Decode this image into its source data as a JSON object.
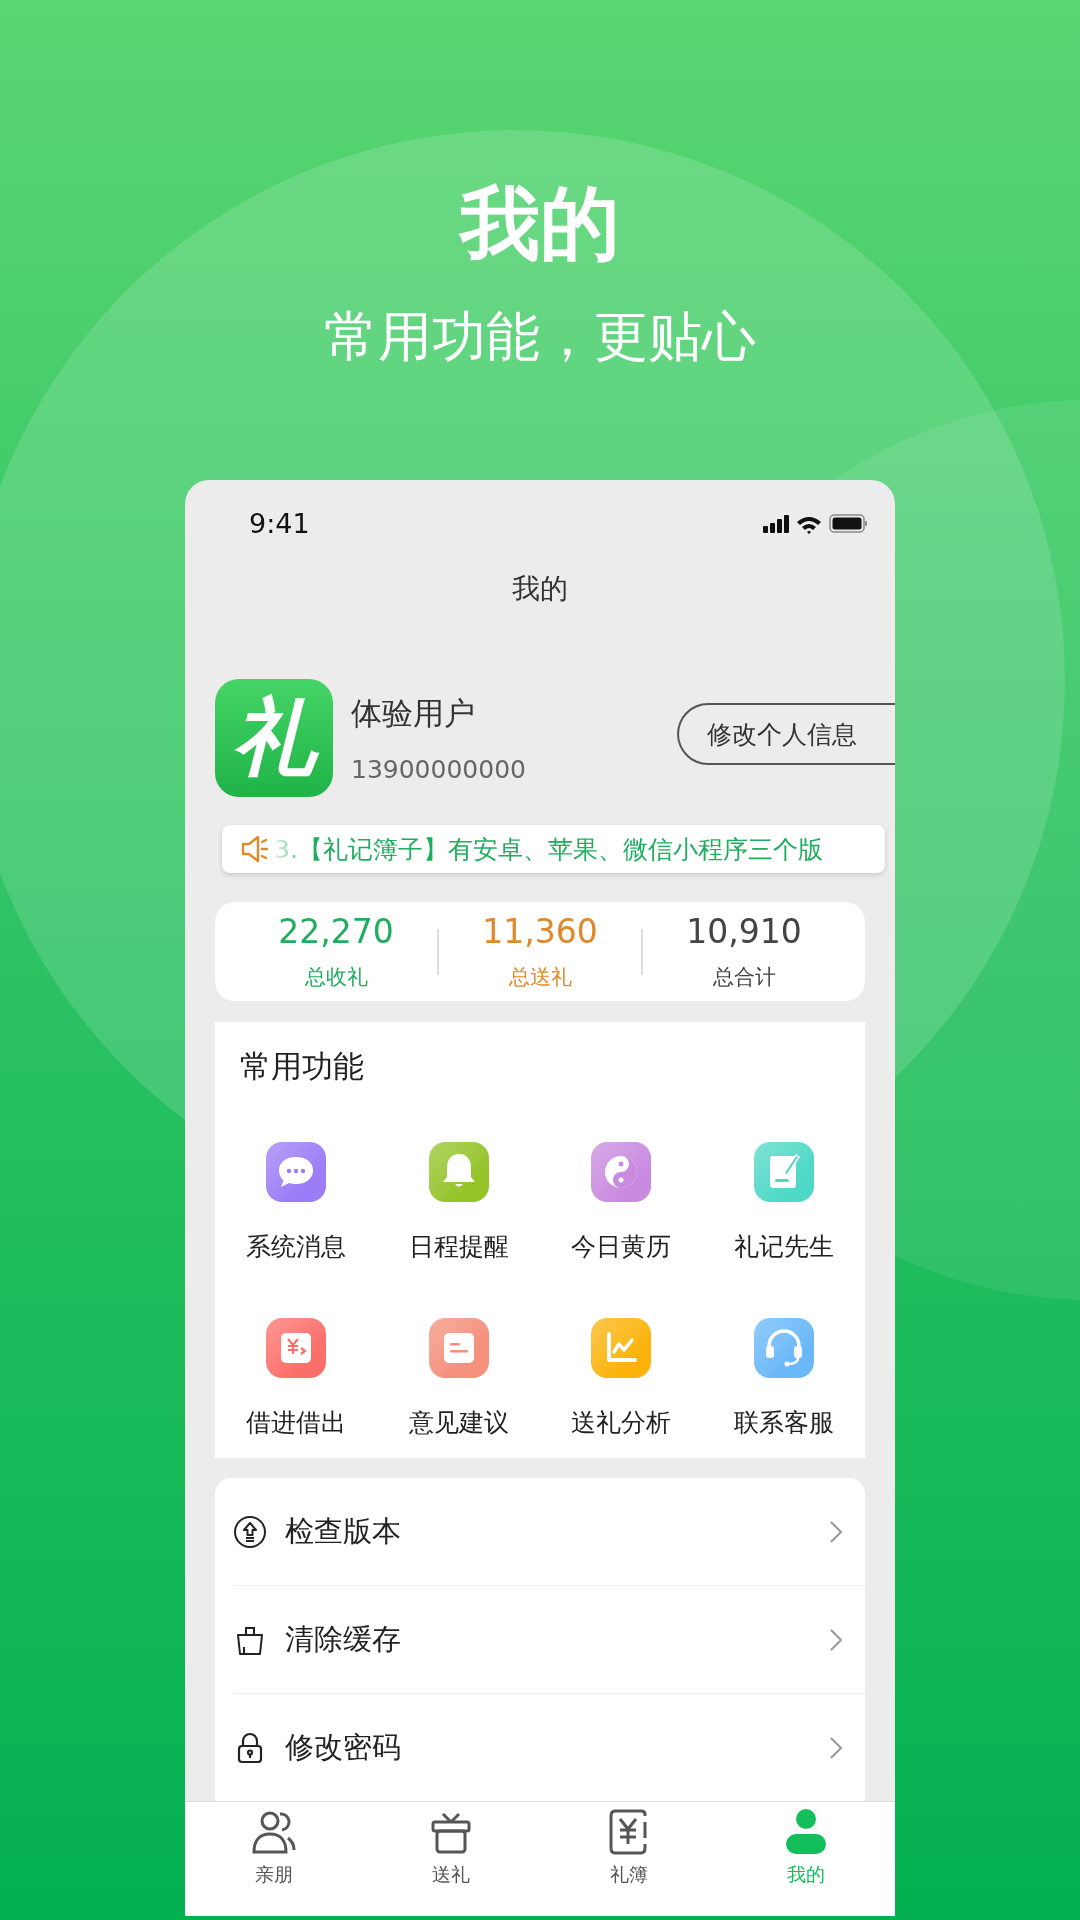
{
  "header": {
    "title": "我的",
    "subtitle": "常用功能，更贴心"
  },
  "status_bar": {
    "time": "9:41"
  },
  "page_title": "我的",
  "profile": {
    "avatar_text": "礼",
    "name": "体验用户",
    "phone": "13900000000",
    "edit_button": "修改个人信息"
  },
  "notice": {
    "text": "3.【礼记簿子】有安卓、苹果、微信小程序三个版"
  },
  "stats": [
    {
      "value": "22,270",
      "label": "总收礼",
      "color": "#1fae5f"
    },
    {
      "value": "11,360",
      "label": "总送礼",
      "color": "#e0892b"
    },
    {
      "value": "10,910",
      "label": "总合计",
      "color": "#444444"
    }
  ],
  "functions": {
    "title": "常用功能",
    "items": [
      {
        "label": "系统消息",
        "kind": "chat",
        "color": "#9a7df7"
      },
      {
        "label": "日程提醒",
        "kind": "bell",
        "color": "#94c42a"
      },
      {
        "label": "今日黄历",
        "kind": "yinyang",
        "color": "#c98be0"
      },
      {
        "label": "礼记先生",
        "kind": "note",
        "color": "#4fd8c6"
      },
      {
        "label": "借进借出",
        "kind": "loan",
        "color": "#fb6f6a"
      },
      {
        "label": "意见建议",
        "kind": "feedback",
        "color": "#f4907b"
      },
      {
        "label": "送礼分析",
        "kind": "chart",
        "color": "#fbb30c"
      },
      {
        "label": "联系客服",
        "kind": "headset",
        "color": "#6ab8f8"
      }
    ]
  },
  "menu": [
    {
      "label": "检查版本",
      "kind": "upgrade"
    },
    {
      "label": "清除缓存",
      "kind": "bucket"
    },
    {
      "label": "修改密码",
      "kind": "lock"
    }
  ],
  "tabs": [
    {
      "label": "亲朋",
      "kind": "friends",
      "selected": false
    },
    {
      "label": "送礼",
      "kind": "gift",
      "selected": false
    },
    {
      "label": "礼簿",
      "kind": "book",
      "selected": false
    },
    {
      "label": "我的",
      "kind": "person",
      "selected": true
    }
  ]
}
